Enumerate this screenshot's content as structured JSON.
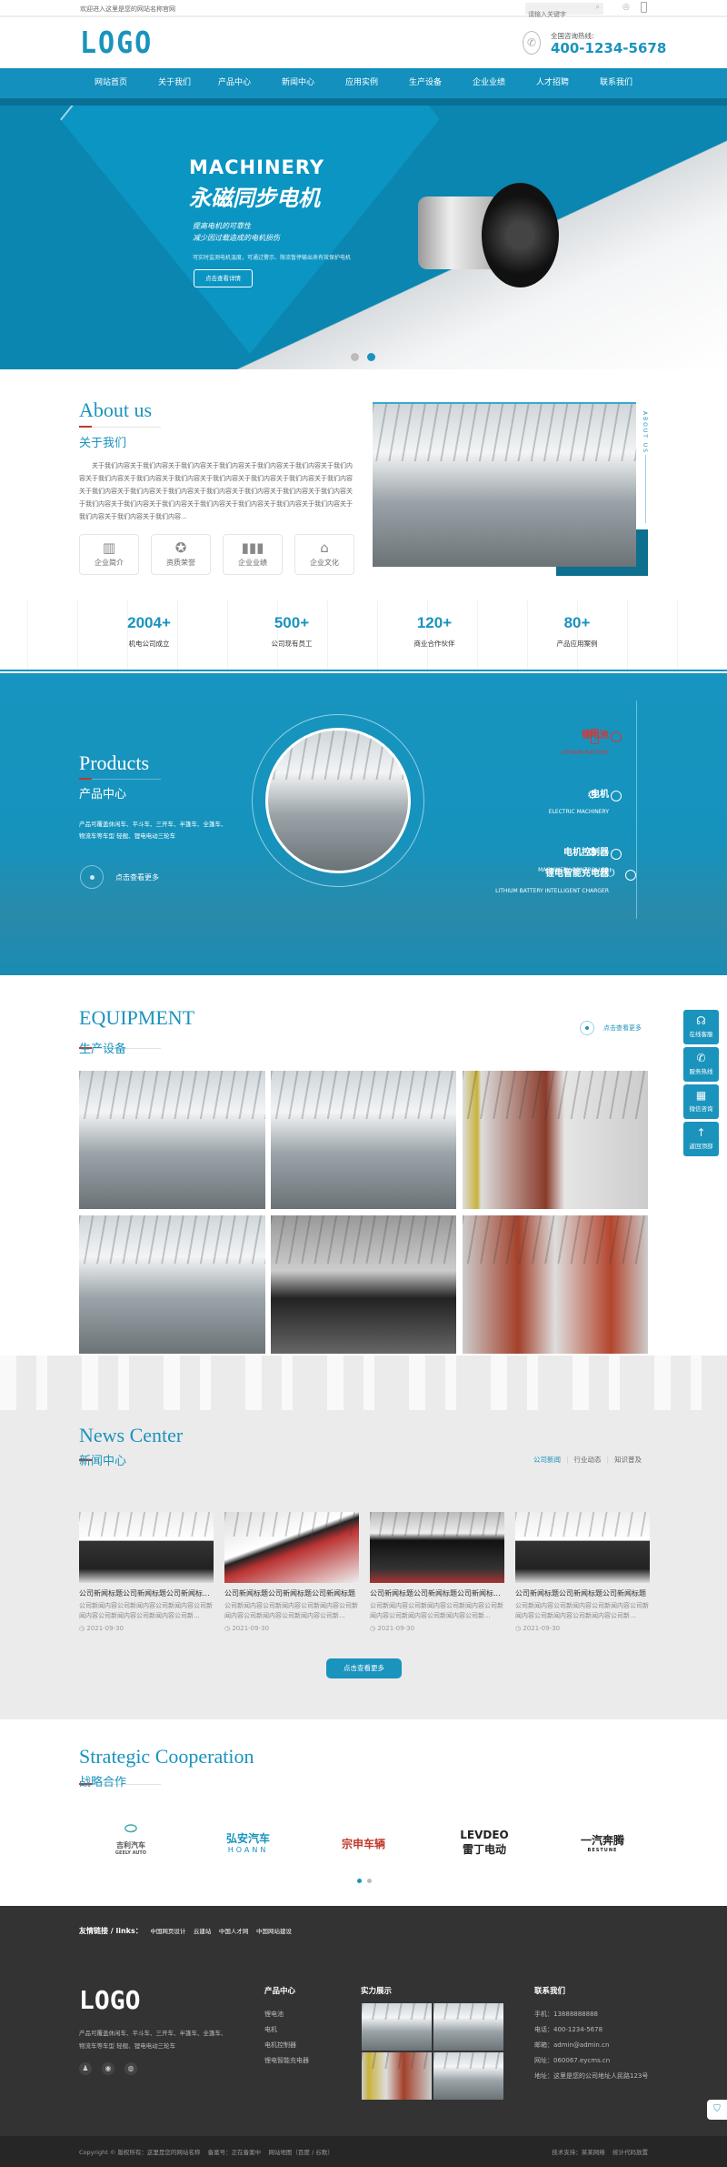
{
  "topbar": {
    "welcome": "欢迎进入这里是您的网站名称官网",
    "search_placeholder": "请输入关键字"
  },
  "header": {
    "logo": "LOGO",
    "hotline_label": "全国咨询热线:",
    "hotline": "400-1234-5678"
  },
  "nav": {
    "items": [
      "网站首页",
      "关于我们",
      "产品中心",
      "新闻中心",
      "应用实例",
      "生产设备",
      "企业业绩",
      "人才招聘",
      "联系我们"
    ],
    "active": 0
  },
  "banner": {
    "title_en": "MACHINERY",
    "title_cn": "永磁同步电机",
    "line1": "提高电机的可靠性",
    "line2": "减少因过载造成的电机损伤",
    "desc": "可实时监测电机温度，可通过警示、限流暂停输出来有效保护电机",
    "button": "点击查看详情",
    "slides": 2,
    "active_slide": 1
  },
  "about": {
    "title_en": "About us",
    "title_cn": "关于我们",
    "side_label": "ABOUT US",
    "text": "关于我们内容关于我们内容关于我们内容关于我们内容关于我们内容关于我们内容关于我们内容关于我们内容关于我们内容关于我们内容关于我们内容关于我们内容关于我们内容关于我们内容关于我们内容关于我们内容关于我们内容关于我们内容关于我们内容关于我们内容关于我们内容关于我们内容关于我们内容关于我们内容关于我们内容关于我们内容关于我们内容关于我们内容关于我们内容关于我们内容关于我们内容...",
    "links": [
      {
        "label": "企业简介",
        "icon": "building-icon"
      },
      {
        "label": "资质荣誉",
        "icon": "medal-icon"
      },
      {
        "label": "企业业绩",
        "icon": "bar-chart-icon"
      },
      {
        "label": "企业文化",
        "icon": "culture-icon"
      }
    ]
  },
  "stats": [
    {
      "value": "2004+",
      "label": "机电公司成立"
    },
    {
      "value": "500+",
      "label": "公司现有员工"
    },
    {
      "value": "120+",
      "label": "商业合作伙伴"
    },
    {
      "value": "80+",
      "label": "产品应用案例"
    }
  ],
  "products": {
    "title_en": "Products",
    "title_cn": "产品中心",
    "desc": "产品可覆盖休闲车、平斗车、三开车、半篷车、全篷车、物流车等车型 轻舰、锂电电动三轮车",
    "more": "点击查看更多",
    "items": [
      {
        "cn": "锂电池",
        "en": "LITHIUM BATTERY",
        "active": true
      },
      {
        "cn": "电机",
        "en": "ELECTRIC MACHINERY"
      },
      {
        "cn": "电机控制器",
        "en": "MACHINERY CONTROLLER"
      },
      {
        "cn": "锂电智能充电器",
        "en": "LITHIUM BATTERY INTELLIGENT CHARGER"
      }
    ]
  },
  "equipment": {
    "title_en": "EQUIPMENT",
    "title_cn": "生产设备",
    "more": "点击查看更多",
    "count": 6
  },
  "side_tools": [
    {
      "label": "在线客服",
      "icon": "headset-icon"
    },
    {
      "label": "服务热线",
      "icon": "phone-icon"
    },
    {
      "label": "微信咨询",
      "icon": "qrcode-icon"
    },
    {
      "label": "返回顶部",
      "icon": "arrow-up-icon"
    }
  ],
  "news": {
    "title_en": "News Center",
    "title_cn": "新闻中心",
    "tabs": [
      "公司新闻",
      "行业动态",
      "知识普及"
    ],
    "active_tab": 0,
    "more": "点击查看更多",
    "items": [
      {
        "title": "公司新闻标题公司新闻标题公司新闻标...",
        "content": "公司新闻内容公司新闻内容公司新闻内容公司新闻内容公司新闻内容公司新闻内容公司新...",
        "date": "2021-09-30"
      },
      {
        "title": "公司新闻标题公司新闻标题公司新闻标题",
        "content": "公司新闻内容公司新闻内容公司新闻内容公司新闻内容公司新闻内容公司新闻内容公司新...",
        "date": "2021-09-30"
      },
      {
        "title": "公司新闻标题公司新闻标题公司新闻标...",
        "content": "公司新闻内容公司新闻内容公司新闻内容公司新闻内容公司新闻内容公司新闻内容公司新...",
        "date": "2021-09-30"
      },
      {
        "title": "公司新闻标题公司新闻标题公司新闻标题",
        "content": "公司新闻内容公司新闻内容公司新闻内容公司新闻内容公司新闻内容公司新闻内容公司新...",
        "date": "2021-09-30"
      }
    ]
  },
  "partners": {
    "title_en": "Strategic Cooperation",
    "title_cn": "战略合作",
    "logos": [
      {
        "name": "吉利汽车",
        "sub": "GEELY AUTO",
        "color": "#555555"
      },
      {
        "name": "弘安汽车",
        "sub": "HOANN",
        "color": "#1a93bd"
      },
      {
        "name": "宗申车辆",
        "sub": "",
        "color": "#c0392b"
      },
      {
        "name": "雷丁电动",
        "sub": "LEVDEO",
        "color": "#222222"
      },
      {
        "name": "一汽奔腾",
        "sub": "BESTUNE",
        "color": "#222222"
      }
    ],
    "dots": 2,
    "active_dot": 0
  },
  "footer": {
    "links_label": "友情链接 / links：",
    "links": [
      "中国网页设计",
      "云建站",
      "中国人才网",
      "中国网站建设"
    ],
    "logo": "LOGO",
    "desc": "产品可覆盖休闲车、平斗车、三开车、半篷车、全篷车、物流车等车型 轻舰、锂电电动三轮车",
    "products_title": "产品中心",
    "products": [
      "锂电池",
      "电机",
      "电机控制器",
      "锂电智能充电器"
    ],
    "show_title": "实力展示",
    "contact_title": "联系我们",
    "contact": [
      "手机：13888888888",
      "电话：400-1234-5678",
      "邮箱：admin@admin.cn",
      "网址：060067.eycms.cn",
      "地址：这里是您的公司地址人民路123号"
    ],
    "copyright": "Copyright © 版权所有：这里是您的网站名称    备案号：正在备案中    网站地图（百度 / 谷歌）",
    "support": "技术支持：某某网络    统计代码放置"
  },
  "colors": {
    "brand": "#1a93bd",
    "accent_red": "#c0392b",
    "footer_bg": "#333333"
  }
}
